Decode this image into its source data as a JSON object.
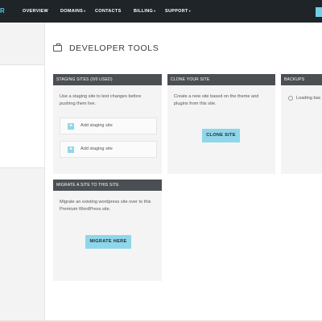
{
  "topbar": {
    "logo_fragment": "R",
    "nav": [
      {
        "label": "OVERVIEW",
        "has_caret": false
      },
      {
        "label": "DOMAINS",
        "has_caret": true
      },
      {
        "label": "CONTACTS",
        "has_caret": false
      },
      {
        "label": "BILLING",
        "has_caret": true
      },
      {
        "label": "SUPPORT",
        "has_caret": true
      }
    ],
    "caret": "▾"
  },
  "page": {
    "title": "DEVELOPER TOOLS"
  },
  "cards": {
    "staging": {
      "header": "STAGING SITES (0/0 USED)",
      "description": "Use a staging site to test changes before pushing them live.",
      "items": [
        {
          "label": "Add staging site"
        },
        {
          "label": "Add staging site"
        }
      ],
      "plus_symbol": "+"
    },
    "clone": {
      "header": "CLONE YOUR SITE",
      "description": "Create a new site based on the theme and plugins from this site.",
      "button_label": "CLONE SITE"
    },
    "backups": {
      "header": "BACKUPS",
      "loading_text": "Loading bac"
    },
    "migrate": {
      "header": "MIGRATE A SITE TO THIS SITE",
      "description": "Migrate an existing wordpress site over to this Premium WordPress site.",
      "button_label": "MIGRATE HERE"
    }
  },
  "colors": {
    "topbar": "#1f2429",
    "accent": "#8fd6ea",
    "card_header": "#4b4f54",
    "card_bg": "#f4f4f4"
  }
}
